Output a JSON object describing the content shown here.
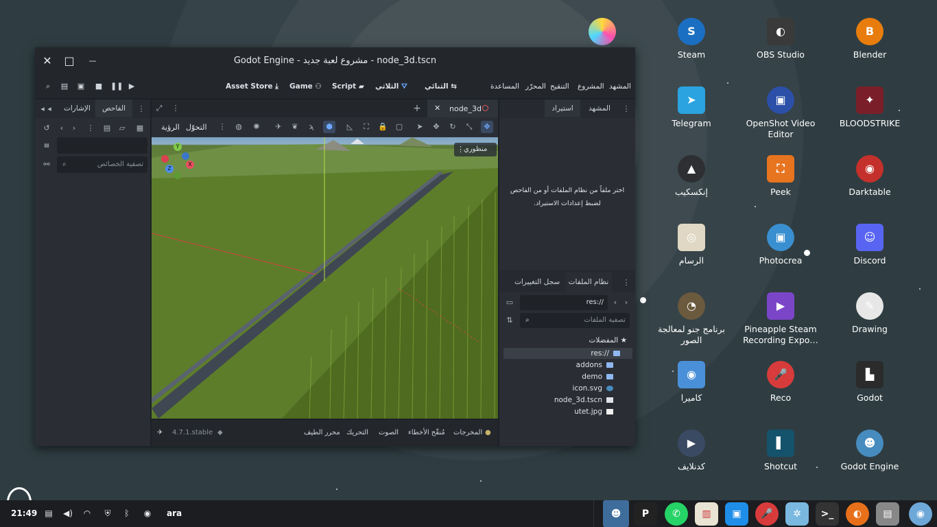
{
  "desktop": {
    "icons": [
      {
        "label": "Steam",
        "color": "#1b6fc2",
        "glyph": "S"
      },
      {
        "label": "OBS Studio",
        "color": "#3a3a3a",
        "glyph": "◐"
      },
      {
        "label": "Blender",
        "color": "#e87d0d",
        "glyph": "B"
      },
      {
        "label": "Telegram",
        "color": "#2aa3e0",
        "glyph": "➤"
      },
      {
        "label": "OpenShot Video Editor",
        "color": "#2c4fa8",
        "glyph": "▣"
      },
      {
        "label": "BLOODSTRIKE",
        "color": "#7a1f2a",
        "glyph": "✦"
      },
      {
        "label": "إنكسكيب",
        "color": "#2d2f33",
        "glyph": "▲"
      },
      {
        "label": "Peek",
        "color": "#e7741f",
        "glyph": "⛶"
      },
      {
        "label": "Darktable",
        "color": "#c4302b",
        "glyph": "◉"
      },
      {
        "label": "الرسام",
        "color": "#e0d8c4",
        "glyph": "◎"
      },
      {
        "label": "Photocrea",
        "color": "#3a8fd1",
        "glyph": "▣"
      },
      {
        "label": "Discord",
        "color": "#5865f2",
        "glyph": "☺"
      },
      {
        "label": "برنامج جنو لمعالجة الصور",
        "color": "#6b5a3e",
        "glyph": "◔"
      },
      {
        "label": "Pineapple Steam Recording Expo…",
        "color": "#7b45c8",
        "glyph": "▶"
      },
      {
        "label": "Drawing",
        "color": "#e7e7e7",
        "glyph": "✎"
      },
      {
        "label": "كاميرا",
        "color": "#4a90d9",
        "glyph": "◉"
      },
      {
        "label": "Reco",
        "color": "#d83b3b",
        "glyph": "🎤"
      },
      {
        "label": "Godot",
        "color": "#2b2b2b",
        "glyph": "▙"
      },
      {
        "label": "كدنلايف",
        "color": "#3a4a63",
        "glyph": "▶"
      },
      {
        "label": "Shotcut",
        "color": "#14536b",
        "glyph": "▌"
      },
      {
        "label": "Godot Engine",
        "color": "#478cbf",
        "glyph": "☻"
      }
    ]
  },
  "window": {
    "title": "Godot Engine - مشروع لعبة جديد - node_3d.tscn",
    "close_glyph": "✕",
    "maximize_glyph": "□",
    "minimize_glyph": "—"
  },
  "menubar": {
    "menus": [
      "المشهد",
      "المشروع",
      "التنقيح",
      "المحرّر",
      "المساعدة"
    ],
    "workspaces": {
      "view2d": "الثنائي",
      "view3d": "الثلاثي",
      "script": "Script",
      "game": "Game",
      "assetstore": "Asset Store"
    }
  },
  "left_dock": {
    "tabs": {
      "inspector": "الفاحص",
      "signals": "الإشارات"
    },
    "filter_placeholder": "تصفية الخصائص"
  },
  "scene_tab": {
    "name": "node_3d",
    "new_tab": "+"
  },
  "viewport_toolbar": {
    "transform": "التحوّل",
    "view": "الرؤية"
  },
  "viewport": {
    "perspective_label": "منظوري"
  },
  "right_dock": {
    "tabs": {
      "scene": "المشهد",
      "import": "استيراد"
    },
    "import_message": "اختر ملفاً من نظام الملفات أو من الفاحص لضبط إعدادات الاستيراد.",
    "bottom_tabs": {
      "filesystem": "نظام الملفات",
      "history": "سجل التغييرات"
    },
    "path": "res://",
    "files_filter_placeholder": "تصفية الملفات",
    "favorites": "المفضلات",
    "tree": [
      {
        "name": "res://",
        "type": "folder"
      },
      {
        "name": "addons",
        "type": "folder"
      },
      {
        "name": "demo",
        "type": "folder"
      },
      {
        "name": "icon.svg",
        "type": "svg"
      },
      {
        "name": "node_3d.tscn",
        "type": "scene"
      },
      {
        "name": "utet.jpg",
        "type": "image"
      }
    ]
  },
  "bottom_panel": {
    "version": "4.7.1.stable",
    "tabs": [
      "المخرجات",
      "مُنقّح الأخطاء",
      "الصوت",
      "التحريك",
      "محرر الطيف"
    ]
  },
  "taskbar": {
    "time": "21:49",
    "lang": "ara"
  }
}
